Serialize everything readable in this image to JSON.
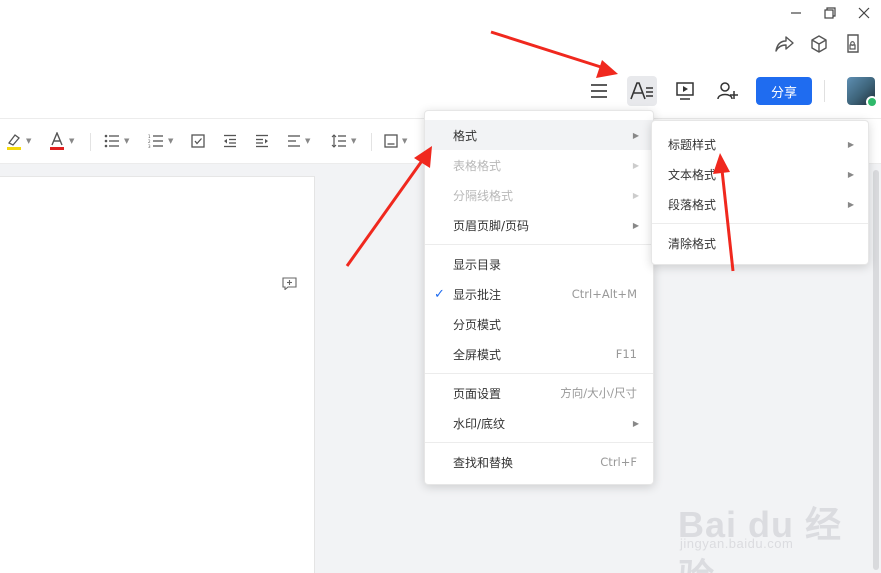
{
  "header": {
    "share_label": "分享"
  },
  "menu": {
    "items": [
      {
        "label": "格式",
        "shortcut": "",
        "disabled": false
      },
      {
        "label": "表格格式",
        "shortcut": "",
        "disabled": true
      },
      {
        "label": "分隔线格式",
        "shortcut": "",
        "disabled": true
      },
      {
        "label": "页眉页脚/页码",
        "shortcut": "",
        "disabled": false
      },
      {
        "label": "显示目录",
        "shortcut": "",
        "disabled": false
      },
      {
        "label": "显示批注",
        "shortcut": "Ctrl+Alt+M",
        "disabled": false
      },
      {
        "label": "分页模式",
        "shortcut": "",
        "disabled": false
      },
      {
        "label": "全屏模式",
        "shortcut": "F11",
        "disabled": false
      },
      {
        "label": "页面设置",
        "shortcut": "方向/大小/尺寸",
        "disabled": false
      },
      {
        "label": "水印/底纹",
        "shortcut": "",
        "disabled": false
      },
      {
        "label": "查找和替换",
        "shortcut": "Ctrl+F",
        "disabled": false
      }
    ]
  },
  "submenu": {
    "items": [
      {
        "label": "标题样式"
      },
      {
        "label": "文本格式"
      },
      {
        "label": "段落格式"
      },
      {
        "label": "清除格式"
      }
    ]
  },
  "watermark": {
    "brand": "Bai du 经验",
    "url": "jingyan.baidu.com"
  },
  "colors": {
    "accent": "#1f6cf0",
    "arrow": "#f0281e",
    "highlight_underline": "#f5d90a",
    "font_color_underline": "#e02020"
  }
}
